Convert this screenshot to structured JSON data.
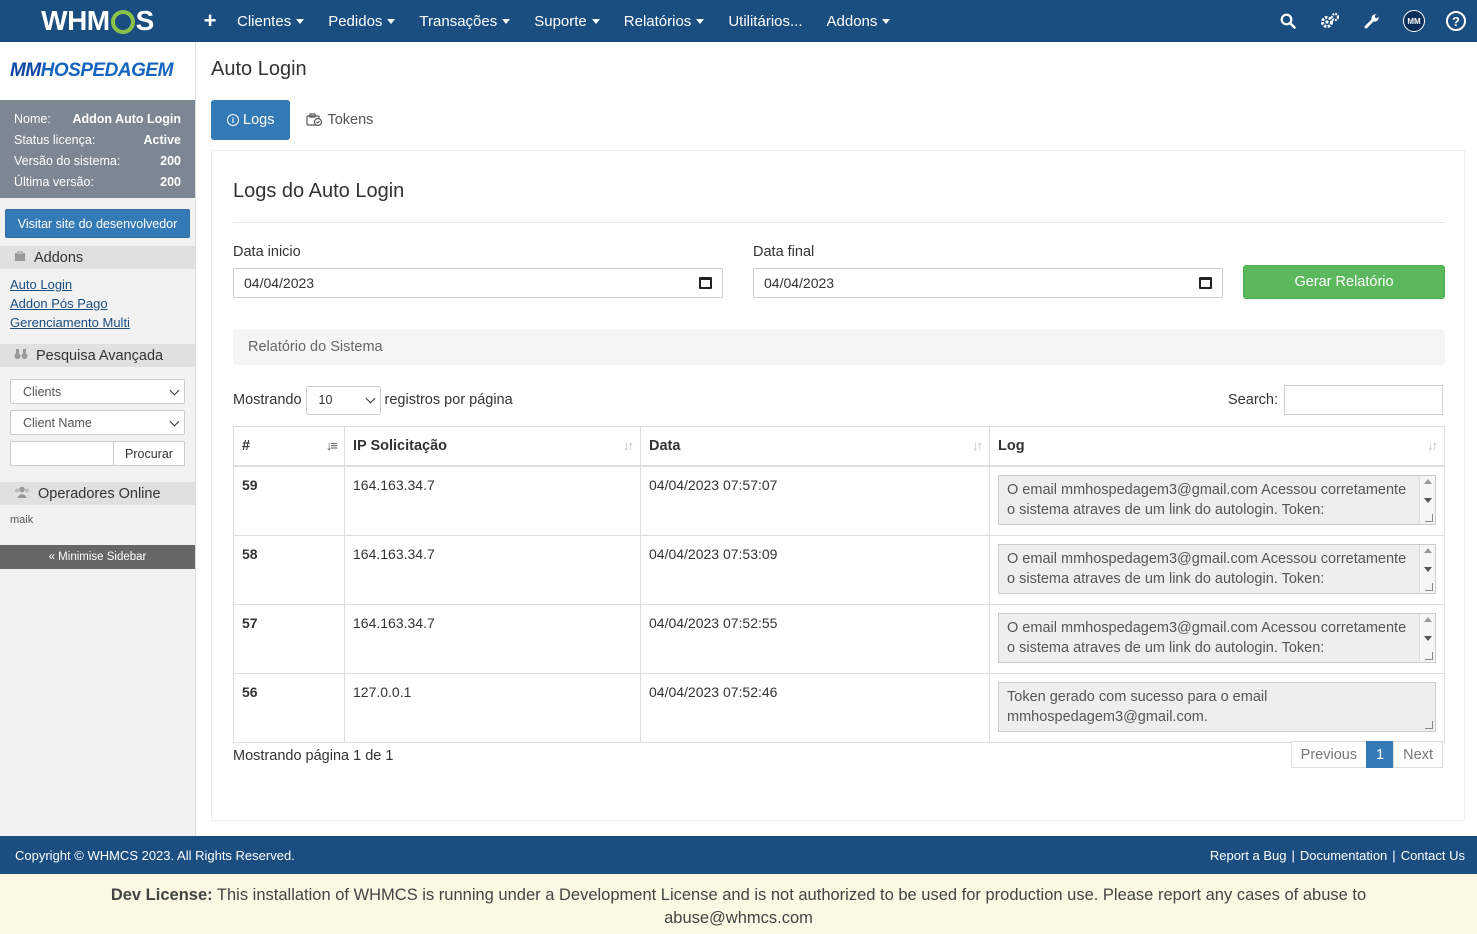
{
  "topnav": {
    "logo": "WHMCS",
    "menu": [
      {
        "label": "Clientes",
        "caret": true
      },
      {
        "label": "Pedidos",
        "caret": true
      },
      {
        "label": "Transações",
        "caret": true
      },
      {
        "label": "Suporte",
        "caret": true
      },
      {
        "label": "Relatórios",
        "caret": true
      },
      {
        "label": "Utilitários...",
        "caret": false
      },
      {
        "label": "Addons",
        "caret": true
      }
    ],
    "icons": [
      "search-icon",
      "gears-icon",
      "wrench-icon",
      "avatar",
      "help-icon"
    ],
    "avatar_text": "MM"
  },
  "sidebar": {
    "brand": {
      "prefix": "MM",
      "rest": "HOSPEDAGEM"
    },
    "license": [
      {
        "label": "Nome:",
        "value": "Addon Auto Login"
      },
      {
        "label": "Status licença:",
        "value": "Active"
      },
      {
        "label": "Versão do sistema:",
        "value": "200"
      },
      {
        "label": "Última versão:",
        "value": "200"
      }
    ],
    "visit_button": "Visitar site do desenvolvedor",
    "addons_title": "Addons",
    "addons_links": [
      "Auto Login",
      "Addon Pós Pago",
      "Gerenciamento Multi"
    ],
    "search_title": "Pesquisa Avançada",
    "search_type": "Clients",
    "search_field": "Client Name",
    "search_button": "Procurar",
    "online_title": "Operadores Online",
    "online_user": "maik",
    "minimise": "« Minimise Sidebar"
  },
  "main": {
    "page_title": "Auto Login",
    "tabs": [
      {
        "label": "Logs",
        "active": true
      },
      {
        "label": "Tokens",
        "active": false
      }
    ],
    "panel_title": "Logs do Auto Login",
    "date_start_label": "Data inicio",
    "date_start": "04/04/2023",
    "date_end_label": "Data final",
    "date_end": "04/04/2023",
    "generate_button": "Gerar Relatório",
    "report_bar": "Relatório do Sistema",
    "length_prefix": "Mostrando",
    "length_value": "10",
    "length_suffix": "registros por página",
    "search_label": "Search:",
    "table": {
      "columns": [
        "#",
        "IP Solicitação",
        "Data",
        "Log"
      ],
      "rows": [
        {
          "id": "59",
          "ip": "164.163.34.7",
          "date": "04/04/2023 07:57:07",
          "log": "O email mmhospedagem3@gmail.com Acessou corretamente o sistema atraves de um link do autologin. Token:",
          "scroll": true
        },
        {
          "id": "58",
          "ip": "164.163.34.7",
          "date": "04/04/2023 07:53:09",
          "log": "O email mmhospedagem3@gmail.com Acessou corretamente o sistema atraves de um link do autologin. Token:",
          "scroll": true
        },
        {
          "id": "57",
          "ip": "164.163.34.7",
          "date": "04/04/2023 07:52:55",
          "log": "O email mmhospedagem3@gmail.com Acessou corretamente o sistema atraves de um link do autologin. Token:",
          "scroll": true
        },
        {
          "id": "56",
          "ip": "127.0.0.1",
          "date": "04/04/2023 07:52:46",
          "log": "Token gerado com sucesso para o email mmhospedagem3@gmail.com.",
          "scroll": false
        }
      ]
    },
    "info": "Mostrando página 1 de 1",
    "pager": {
      "previous": "Previous",
      "current": "1",
      "next": "Next"
    }
  },
  "footer": {
    "copyright": "Copyright © WHMCS 2023. All Rights Reserved.",
    "links": [
      "Report a Bug",
      "Documentation",
      "Contact Us"
    ]
  },
  "dev_license": {
    "label": "Dev License:",
    "text": "This installation of WHMCS is running under a Development License and is not authorized to be used for production use. Please report any cases of abuse to abuse@whmcs.com"
  }
}
